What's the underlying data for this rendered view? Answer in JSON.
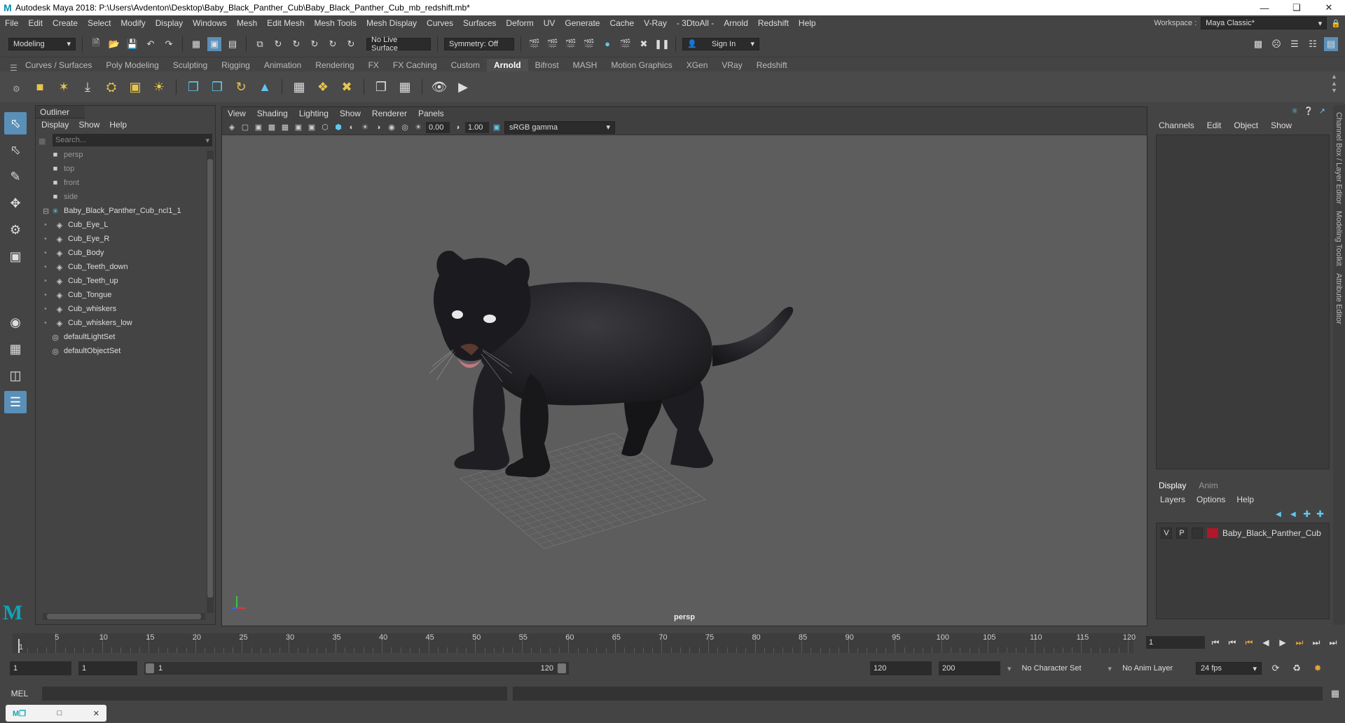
{
  "window": {
    "title": "Autodesk Maya 2018: P:\\Users\\Avdenton\\Desktop\\Baby_Black_Panther_Cub\\Baby_Black_Panther_Cub_mb_redshift.mb*"
  },
  "menubar": {
    "items": [
      "File",
      "Edit",
      "Create",
      "Select",
      "Modify",
      "Display",
      "Windows",
      "Mesh",
      "Edit Mesh",
      "Mesh Tools",
      "Mesh Display",
      "Curves",
      "Surfaces",
      "Deform",
      "UV",
      "Generate",
      "Cache",
      "V-Ray",
      "- 3DtoAll -",
      "Arnold",
      "Redshift",
      "Help"
    ],
    "workspace_label": "Workspace :",
    "workspace_value": "Maya Classic*"
  },
  "statusline": {
    "mode": "Modeling",
    "live_surface": "No Live Surface",
    "symmetry": "Symmetry: Off",
    "sign_in": "Sign In"
  },
  "shelf": {
    "tabs": [
      "Curves / Surfaces",
      "Poly Modeling",
      "Sculpting",
      "Rigging",
      "Animation",
      "Rendering",
      "FX",
      "FX Caching",
      "Custom",
      "Arnold",
      "Bifrost",
      "MASH",
      "Motion Graphics",
      "XGen",
      "VRay",
      "Redshift"
    ],
    "active_tab": "Arnold"
  },
  "outliner": {
    "title": "Outliner",
    "menu": [
      "Display",
      "Show",
      "Help"
    ],
    "search_placeholder": "Search...",
    "items": [
      {
        "label": "persp",
        "icon": "camera-icon",
        "indent": 1,
        "dim": true
      },
      {
        "label": "top",
        "icon": "camera-icon",
        "indent": 1,
        "dim": true
      },
      {
        "label": "front",
        "icon": "camera-icon",
        "indent": 1,
        "dim": true
      },
      {
        "label": "side",
        "icon": "camera-icon",
        "indent": 1,
        "dim": true
      },
      {
        "label": "Baby_Black_Panther_Cub_ncl1_1",
        "icon": "group-icon",
        "indent": 0,
        "dim": false
      },
      {
        "label": "Cub_Eye_L",
        "icon": "mesh-icon",
        "indent": 2,
        "dim": false
      },
      {
        "label": "Cub_Eye_R",
        "icon": "mesh-icon",
        "indent": 2,
        "dim": false
      },
      {
        "label": "Cub_Body",
        "icon": "mesh-icon",
        "indent": 2,
        "dim": false
      },
      {
        "label": "Cub_Teeth_down",
        "icon": "mesh-icon",
        "indent": 2,
        "dim": false
      },
      {
        "label": "Cub_Teeth_up",
        "icon": "mesh-icon",
        "indent": 2,
        "dim": false
      },
      {
        "label": "Cub_Tongue",
        "icon": "mesh-icon",
        "indent": 2,
        "dim": false
      },
      {
        "label": "Cub_whiskers",
        "icon": "mesh-icon",
        "indent": 2,
        "dim": false
      },
      {
        "label": "Cub_whiskers_low",
        "icon": "mesh-icon",
        "indent": 2,
        "dim": false
      },
      {
        "label": "defaultLightSet",
        "icon": "set-icon",
        "indent": 1,
        "dim": false
      },
      {
        "label": "defaultObjectSet",
        "icon": "set-icon",
        "indent": 1,
        "dim": false
      }
    ]
  },
  "viewport": {
    "menu": [
      "View",
      "Shading",
      "Lighting",
      "Show",
      "Renderer",
      "Panels"
    ],
    "exposure": "0.00",
    "gamma": "1.00",
    "color_space": "sRGB gamma",
    "camera_label": "persp"
  },
  "channelbox": {
    "menu": [
      "Channels",
      "Edit",
      "Object",
      "Show"
    ]
  },
  "layer_editor": {
    "tabs": [
      "Display",
      "Anim"
    ],
    "active_tab": "Display",
    "menu": [
      "Layers",
      "Options",
      "Help"
    ],
    "layers": [
      {
        "v": "V",
        "p": "P",
        "name": "Baby_Black_Panther_Cub",
        "color": "#b2162a"
      }
    ]
  },
  "side_tabs": [
    "Channel Box / Layer Editor",
    "Modeling Toolkit",
    "Attribute Editor"
  ],
  "timeline": {
    "start": 1,
    "end": 120,
    "ticks": [
      5,
      10,
      15,
      20,
      25,
      30,
      35,
      40,
      45,
      50,
      55,
      60,
      65,
      70,
      75,
      80,
      85,
      90,
      95,
      100,
      105,
      110,
      115,
      120
    ],
    "current_frame": "1"
  },
  "range": {
    "start_field": "1",
    "start_field2": "1",
    "range_start": "1",
    "range_end": "120",
    "end_field": "120",
    "end_field2": "200",
    "character_set": "No Character Set",
    "anim_layer": "No Anim Layer",
    "fps": "24 fps"
  },
  "cmdline": {
    "label": "MEL"
  }
}
